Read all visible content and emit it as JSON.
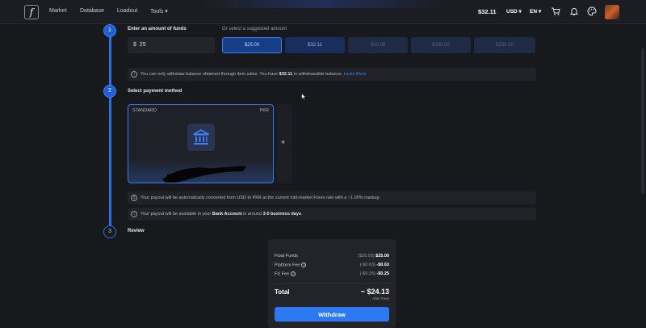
{
  "nav": {
    "logo": "f",
    "items": [
      "Market",
      "Database",
      "Loadout",
      "Tools"
    ],
    "balance": "$32.11",
    "currency": "USD",
    "language": "EN"
  },
  "steps": [
    "1",
    "2",
    "3"
  ],
  "amount": {
    "label": "Enter an amount of funds",
    "suggest_label": "Or select a suggested amount",
    "input_currency": "$",
    "input_value": "25",
    "options": [
      "$25.00",
      "$32.11",
      "$50.00",
      "$150.00",
      "$250.00"
    ],
    "selected": "$25.00"
  },
  "withdraw_notice": {
    "text": "You can only withdraw balance obtained through item sales. You have ",
    "amount": "$32.11",
    "suffix": " in withdrawable balance. ",
    "link": "Learn More"
  },
  "payment": {
    "label": "Select payment method",
    "card_title": "STANDARD",
    "card_currency": "PKR",
    "add": "+"
  },
  "conversion_notice": "Your payout will be automatically converted from USD to PKR at the current mid-market Forex rate with a ~1.00% markup.",
  "availability_notice": {
    "prefix": "Your payout will be available in your ",
    "account": "Bank Account",
    "middle": " in around ",
    "days": "3-5 business days",
    "suffix": "."
  },
  "review": {
    "label": "Review",
    "rows": [
      {
        "name": "Float Funds",
        "paren": "($25.00)",
        "value": "$25.00"
      },
      {
        "name": "Platform Fee",
        "paren": "(-$0.63)",
        "value": "-$0.63"
      },
      {
        "name": "FX Fee",
        "paren": "(-$0.25)",
        "value": "-$0.25"
      }
    ],
    "total_label": "Total",
    "total_value": "~ $24.13",
    "after_fees": "After Fees",
    "button": "Withdraw"
  },
  "colors": {
    "accent": "#2d7af0",
    "background": "#18191d",
    "panel": "#22242a"
  }
}
